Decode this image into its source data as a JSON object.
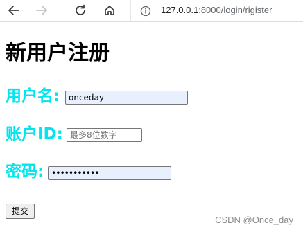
{
  "browser": {
    "url_host": "127.0.0.1",
    "url_path": ":8000/login/rigister"
  },
  "page": {
    "heading": "新用户注册",
    "username": {
      "label": "用户名:",
      "value": "onceday"
    },
    "account_id": {
      "label": "账户ID:",
      "value": "",
      "placeholder": "最多8位数字"
    },
    "password": {
      "label": "密码:",
      "value": "•••••••••••"
    },
    "submit_label": "提交"
  },
  "watermark": "CSDN @Once_day",
  "colors": {
    "label": "#00e5ee",
    "autofill": "#e8f0fe"
  }
}
